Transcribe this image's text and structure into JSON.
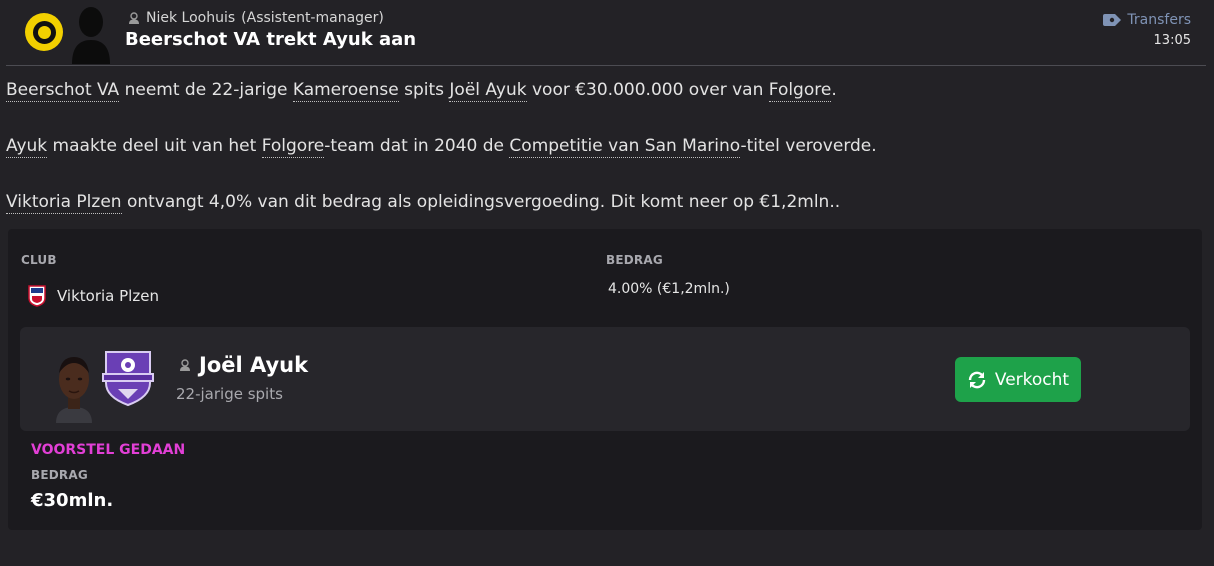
{
  "header": {
    "club_badge_icon": "club-crest-icon",
    "sender_name": "Niek Loohuis",
    "sender_role": "(Assistent-manager)",
    "headline": "Beerschot VA trekt Ayuk aan",
    "category": "Transfers",
    "time": "13:05"
  },
  "message": {
    "p1": {
      "club": "Beerschot VA",
      "t1": " neemt de 22-jarige ",
      "nationality": "Kameroense",
      "t2": " spits ",
      "player": "Joël Ayuk",
      "t3": " voor €30.000.000 over van ",
      "from_club": "Folgore",
      "t4": "."
    },
    "p2": {
      "player": "Ayuk",
      "t1": " maakte deel uit van het ",
      "team": "Folgore",
      "t2": "-team dat in 2040 de ",
      "competition": "Competitie van San Marino",
      "t3": "-titel veroverde."
    },
    "p3": {
      "club": "Viktoria Plzen",
      "t1": " ontvangt 4,0% van dit bedrag als opleidingsvergoeding. Dit komt neer op €1,2mln.."
    }
  },
  "card": {
    "col_club": "CLUB",
    "col_amount": "BEDRAG",
    "club_name": "Viktoria Plzen",
    "amount": "4.00% (€1,2mln.)",
    "player": {
      "name": "Joël Ayuk",
      "description": "22-jarige spits",
      "status_button": "Verkocht"
    },
    "offer_label": "VOORSTEL GEDAAN",
    "offer_amount_label": "BEDRAG",
    "offer_amount": "€30mln."
  },
  "colors": {
    "background": "#232226",
    "card": "#1b1a1e",
    "player_box": "#27262b",
    "accent_green": "#1ea24a",
    "accent_magenta": "#e23fd6",
    "link_blue": "#7f93b5"
  }
}
